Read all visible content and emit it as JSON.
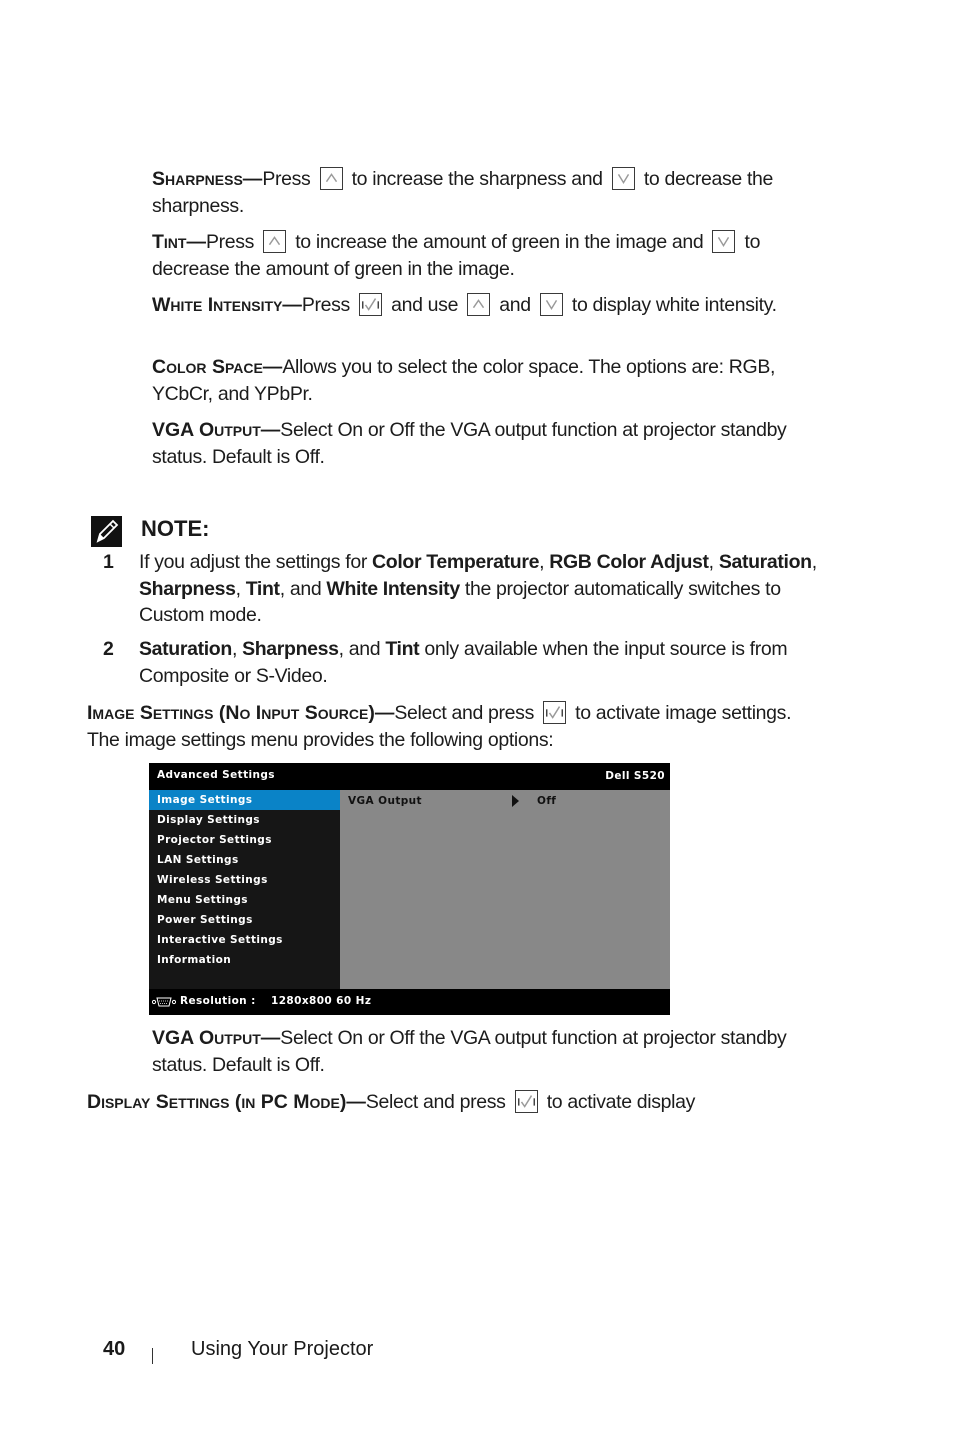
{
  "sharpness": {
    "term": "Sharpness—",
    "t1": "Press",
    "t2": "to increase the sharpness and",
    "t3": "to decrease the sharpness."
  },
  "tint": {
    "term": "Tint—",
    "t1": "Press",
    "t2": "to increase the amount of green in the image and",
    "t3": "to decrease the amount of green in the image."
  },
  "white_intensity": {
    "term": "White Intensity—",
    "t1": "Press",
    "t2": "and use",
    "t3": "and",
    "t4": "to display white intensity."
  },
  "color_space": {
    "term": "Color Space—",
    "text": "Allows you to select the color space. The options are: RGB, YCbCr, and YPbPr."
  },
  "vga_output_1": {
    "term": "VGA Output—",
    "text": "Select On or Off the VGA output function at projector standby status. Default is Off."
  },
  "note": {
    "title": "NOTE:",
    "icon": "pencil-note-icon",
    "items": [
      {
        "num": "1",
        "t1": "If you adjust the settings for ",
        "b1": "Color Temperature",
        "t2": ", ",
        "b2": "RGB Color Adjust",
        "t3": ", ",
        "b3": "Saturation",
        "t4": ", ",
        "b4": "Sharpness",
        "t5": ", ",
        "b5": "Tint",
        "t6": ", and ",
        "b6": "White Intensity",
        "t7": " the projector automatically switches to Custom mode."
      },
      {
        "num": "2",
        "b1": "Saturation",
        "t1": ", ",
        "b2": "Sharpness",
        "t2": ", and ",
        "b3": "Tint",
        "t3": " only available when the input source is from Composite or S-Video."
      }
    ]
  },
  "image_settings": {
    "term": "Image Settings (No Input Source)—",
    "t1": "Select and press",
    "t2": "to activate image settings. The image settings menu provides the following options:"
  },
  "osd": {
    "title": "Advanced Settings",
    "model": "Dell S520",
    "menu": [
      "Image Settings",
      "Display Settings",
      "Projector Settings",
      "LAN Settings",
      "Wireless Settings",
      "Menu Settings",
      "Power Settings",
      "Interactive Settings",
      "Information"
    ],
    "selected_index": 0,
    "option_label": "VGA Output",
    "option_value": "Off",
    "resolution_label": "Resolution :",
    "resolution_value": "1280x800 60 Hz",
    "colors": {
      "selected": "#0a83c7",
      "panel": "#888888",
      "menu_bg": "#161616"
    }
  },
  "vga_output_2": {
    "term": "VGA Output—",
    "text": "Select On or Off the VGA output function at projector standby status. Default is Off."
  },
  "display_settings": {
    "term": "Display Settings (in PC Mode)—",
    "t1": "Select and press",
    "t2": "to activate display"
  },
  "footer": {
    "page_number": "40",
    "section_title": "Using Your Projector"
  }
}
